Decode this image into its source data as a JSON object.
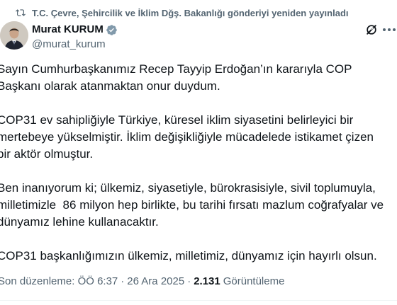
{
  "repost": {
    "text": "T.C. Çevre, Şehircilik ve İklim Dğş. Bakanlığı gönderiyi yeniden yayınladı",
    "icon": "repost-icon"
  },
  "author": {
    "name": "Murat KURUM",
    "handle": "@murat_kurum",
    "verified_icon": "verified-badge-icon",
    "verified_color": "#1d9bf0"
  },
  "actions": {
    "grok_icon": "grok-icon",
    "more_icon": "more-options-icon"
  },
  "tweet": {
    "paragraphs": [
      "Sayın Cumhurbaşkanımız Recep Tayyip Erdoğan’ın kararıyla COP\nBaşkanı olarak atanmaktan onur duydum.",
      "COP31 ev sahipliğiyle Türkiye, küresel iklim siyasetini belirleyici bir\nmertebeye yükselmiştir. İklim değişikliğiyle mücadelede istikamet çizen\nbir aktör olmuştur.",
      "Ben inanıyorum ki; ülkemiz, siyasetiyle, bürokrasisiyle, sivil toplumuyla,\nmilletimizle  86 milyon hep birlikte, bu tarihi fırsatı mazlum coğrafyalar ve\ndünyamız lehine kullanacaktır.",
      "COP31 başkanlığımızın ülkemiz, milletimiz, dünyamız için hayırlı olsun."
    ]
  },
  "meta": {
    "edited_label": "Son düzenleme: ÖÖ 6:37",
    "separator_1": "·",
    "date": "26 Ara 2025",
    "separator_2": "·",
    "views_count": "2.131",
    "views_label": "Görüntüleme"
  },
  "colors": {
    "text_primary": "#0f1419",
    "text_secondary": "#536471",
    "accent": "#1d9bf0"
  }
}
